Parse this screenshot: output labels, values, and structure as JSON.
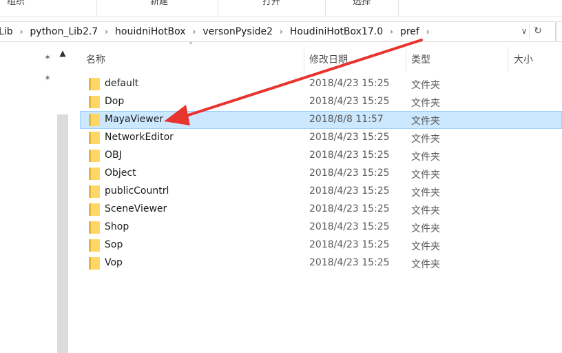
{
  "ribbon": {
    "groups": [
      {
        "label": "组织"
      },
      {
        "label": "新建"
      },
      {
        "label": "打开"
      },
      {
        "label": "选择"
      }
    ]
  },
  "address": {
    "crumbs": [
      {
        "label": "Lib"
      },
      {
        "label": "python_Lib2.7"
      },
      {
        "label": "houidniHotBox"
      },
      {
        "label": "versonPyside2"
      },
      {
        "label": "HoudiniHotBox17.0"
      },
      {
        "label": "pref"
      }
    ]
  },
  "columns": {
    "name": "名称",
    "date": "修改日期",
    "type": "类型",
    "size": "大小"
  },
  "rows": [
    {
      "name": "default",
      "date": "2018/4/23 15:25",
      "type": "文件夹",
      "selected": false
    },
    {
      "name": "Dop",
      "date": "2018/4/23 15:25",
      "type": "文件夹",
      "selected": false
    },
    {
      "name": "MayaViewer",
      "date": "2018/8/8 11:57",
      "type": "文件夹",
      "selected": true
    },
    {
      "name": "NetworkEditor",
      "date": "2018/4/23 15:25",
      "type": "文件夹",
      "selected": false
    },
    {
      "name": "OBJ",
      "date": "2018/4/23 15:25",
      "type": "文件夹",
      "selected": false
    },
    {
      "name": "Object",
      "date": "2018/4/23 15:25",
      "type": "文件夹",
      "selected": false
    },
    {
      "name": "publicCountrl",
      "date": "2018/4/23 15:25",
      "type": "文件夹",
      "selected": false
    },
    {
      "name": "SceneViewer",
      "date": "2018/4/23 15:25",
      "type": "文件夹",
      "selected": false
    },
    {
      "name": "Shop",
      "date": "2018/4/23 15:25",
      "type": "文件夹",
      "selected": false
    },
    {
      "name": "Sop",
      "date": "2018/4/23 15:25",
      "type": "文件夹",
      "selected": false
    },
    {
      "name": "Vop",
      "date": "2018/4/23 15:25",
      "type": "文件夹",
      "selected": false
    }
  ],
  "colors": {
    "selection_bg": "#cce8ff",
    "selection_border": "#99d1ff",
    "annotation_arrow": "#e8342f",
    "folder": "#ffd766"
  },
  "icons": [
    "pin-icon",
    "chevron-right-icon",
    "chevron-down-icon",
    "refresh-icon",
    "folder-icon",
    "sort-up-icon"
  ]
}
